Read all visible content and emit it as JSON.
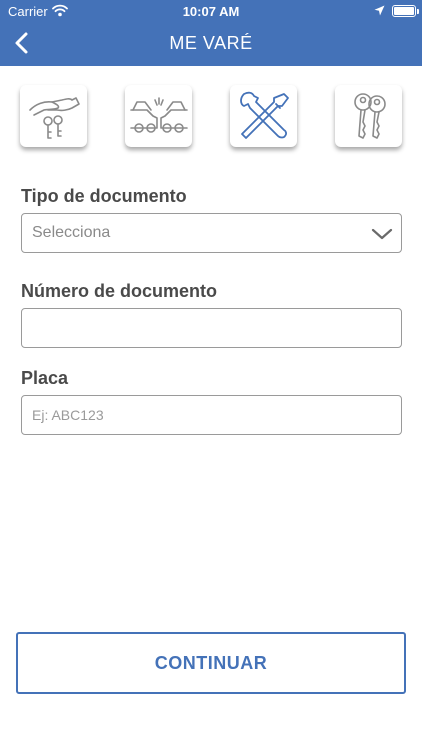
{
  "status_bar": {
    "carrier": "Carrier",
    "time": "10:07 AM",
    "wifi_icon": "wifi-icon",
    "location_icon": "location-arrow-icon",
    "battery_level": 1.0
  },
  "nav": {
    "title": "ME VARÉ",
    "back_icon": "chevron-left-icon"
  },
  "categories": [
    {
      "icon": "hand-with-keys-icon",
      "selected": false
    },
    {
      "icon": "car-collision-icon",
      "selected": false
    },
    {
      "icon": "wrench-screwdriver-icon",
      "selected": true
    },
    {
      "icon": "keys-icon",
      "selected": false
    }
  ],
  "form": {
    "document_type": {
      "label": "Tipo de documento",
      "value": "Selecciona"
    },
    "document_number": {
      "label": "Número de documento",
      "value": "",
      "placeholder": ""
    },
    "plate": {
      "label": "Placa",
      "value": "",
      "placeholder": "Ej: ABC123"
    }
  },
  "actions": {
    "continue_label": "CONTINUAR"
  },
  "colors": {
    "header": "#4472b8",
    "accent": "#4472b8",
    "selected_icon": "#4472b8",
    "icon_gray": "#8a8a8a"
  }
}
